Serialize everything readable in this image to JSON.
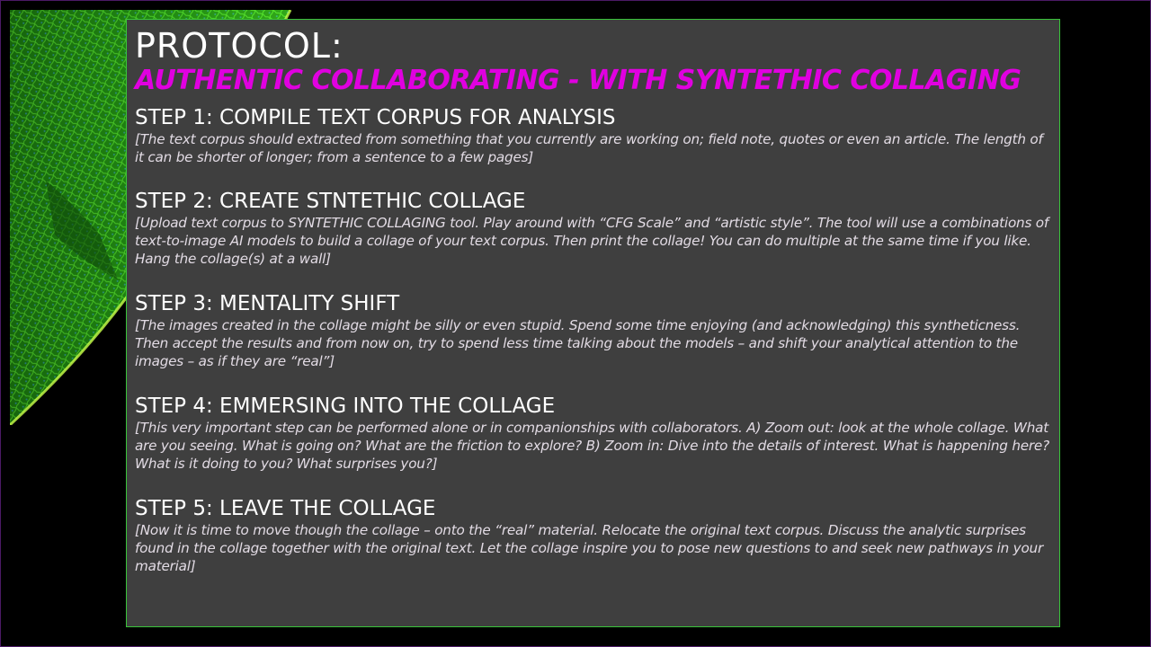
{
  "slide": {
    "title": "PROTOCOL:",
    "subtitle": "AUTHENTIC COLLABORATING - WITH SYNTETHIC COLLAGING",
    "steps": [
      {
        "heading": "STEP 1: COMPILE TEXT CORPUS FOR ANALYSIS",
        "body": "[The text corpus should extracted from something that you currently are working on; field note, quotes or even an article. The length of it can be shorter of longer; from a sentence to a few pages]"
      },
      {
        "heading": "STEP 2: CREATE STNTETHIC COLLAGE",
        "body": "[Upload text corpus to SYNTETHIC COLLAGING tool. Play around with “CFG Scale” and “artistic style”. The tool will use a combinations of text-to-image AI models to build a collage of your text corpus. Then print the collage! You can do multiple at the same time if you like. Hang the collage(s) at a wall]"
      },
      {
        "heading": "STEP 3: MENTALITY SHIFT",
        "body": "[The images created in the collage might be silly or even stupid. Spend some time enjoying (and acknowledging) this syntheticness. Then accept the results and from now on, try to spend less time talking about the models – and shift your analytical attention to the images – as if they are “real”]"
      },
      {
        "heading": "STEP 4: EMMERSING INTO THE COLLAGE",
        "body": "[This very important step can be performed alone or in companionships with collaborators. A) Zoom out: look at the whole collage. What are you seeing. What is going on? What are the friction to explore? B) Zoom in: Dive into the details of interest. What is happening here? What is it doing to you?  What surprises you?]"
      },
      {
        "heading": "STEP 5: LEAVE THE COLLAGE",
        "body": "[Now it is time to move though the collage – onto the “real” material. Relocate the original text corpus. Discuss the analytic surprises found in the collage together with the original text. Let the collage inspire you to pose new questions to and seek new pathways in your material]"
      }
    ]
  },
  "colors": {
    "background": "#000000",
    "panel": "#3f3f3f",
    "panel_border": "#39c43a",
    "accent_magenta": "#e000e0",
    "body_text": "#e2dbe4"
  }
}
